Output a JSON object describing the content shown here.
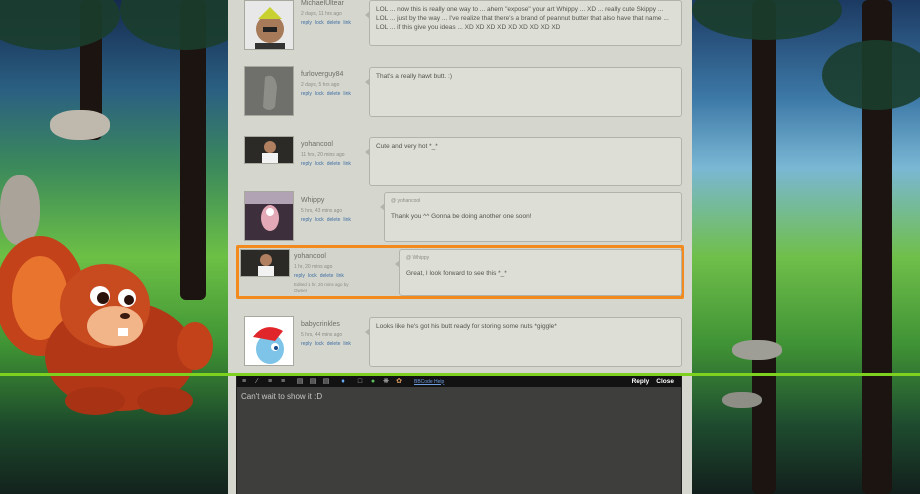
{
  "comments": [
    {
      "username": "MichaelUltear",
      "time": "2 days, 11 hrs ago",
      "actions": [
        "reply",
        "lock",
        "delete",
        "link"
      ],
      "text": "LOL ... now this is really one way to ... ahem \"expose\" your art Whippy ... XD ... really cute Skippy ... LOL ... just by the way ... I've realize that there's a brand of peannut butter that also have that name ... LOL ... if this give you ideas ... XD XD XD XD XD XD XD XD XD",
      "avatar": "avatar-michael"
    },
    {
      "username": "furloverguy84",
      "time": "2 days, 5 hrs ago",
      "actions": [
        "reply",
        "lock",
        "delete",
        "link"
      ],
      "text": "That's a really hawt butt. :)",
      "avatar": "avatar-furlover"
    },
    {
      "username": "yohancool",
      "time": "11 hrs, 20 mins ago",
      "actions": [
        "reply",
        "lock",
        "delete",
        "link"
      ],
      "text": "Cute and very hot *_*",
      "avatar": "avatar-yohan"
    },
    {
      "username": "Whippy",
      "time": "5 hrs, 43 mins ago",
      "actions": [
        "reply",
        "lock",
        "delete",
        "link"
      ],
      "reply_to": "@ yohancool",
      "text": "Thank you ^^ Gonna be doing another one soon!",
      "avatar": "avatar-whippy"
    },
    {
      "username": "yohancool",
      "time": "1 hr, 20 mins ago",
      "actions": [
        "reply",
        "lock",
        "delete",
        "link"
      ],
      "edited": "Edited 1 hr, 20 mins ago by Owner",
      "reply_to": "@ Whippy",
      "text": "Great, I look forward to see this *_*",
      "avatar": "avatar-yohan"
    },
    {
      "username": "babycrinkles",
      "time": "5 hrs, 44 mins ago",
      "actions": [
        "reply",
        "lock",
        "delete",
        "link"
      ],
      "text": "Looks like he's got his butt ready for storing some nuts *giggle*",
      "avatar": "avatar-babycrinkles"
    }
  ],
  "editor": {
    "bbcode_link": "BBCode Help",
    "reply_label": "Reply",
    "close_label": "Close",
    "text": "Can't wait to show it :D",
    "toolbar_icons": [
      "bold-icon",
      "italic-icon",
      "underline-icon",
      "strike-icon",
      "list-icon",
      "quote-icon",
      "code-icon",
      "link-icon",
      "smiley-icon",
      "color-icon",
      "settings-icon",
      "palette-icon"
    ]
  },
  "colors": {
    "highlight": "#f28a1e",
    "accent_line": "#7ed11f",
    "link": "#3f6da3"
  }
}
